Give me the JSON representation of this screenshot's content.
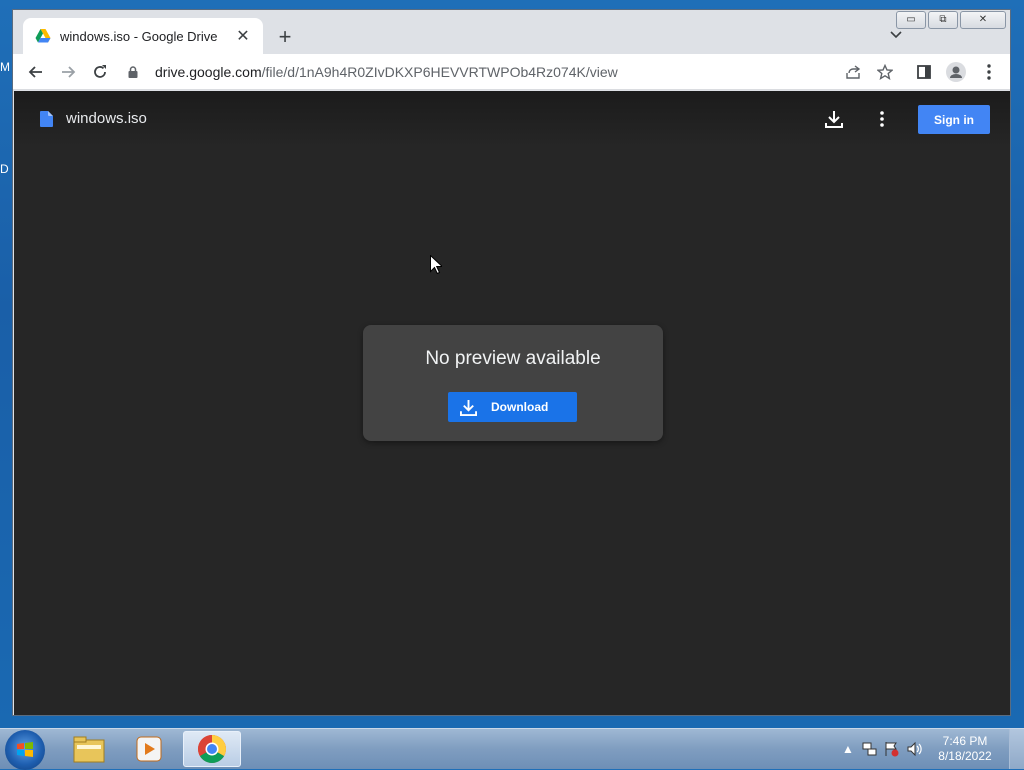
{
  "desktop": {
    "peek1": "M",
    "peek2": "D"
  },
  "tab": {
    "title": "windows.iso - Google Drive",
    "close": "✕",
    "new_tab": "+"
  },
  "window_controls": {
    "minimize": "▭",
    "maximize": "⧉",
    "close": "✕"
  },
  "address_bar": {
    "domain": "drive.google.com",
    "path": "/file/d/1nA9h4R0ZIvDKXP6HEVVRTWPOb4Rz074K/view"
  },
  "viewer": {
    "file_name": "windows.iso",
    "sign_in_label": "Sign in",
    "preview_message": "No preview available",
    "download_label": "Download"
  },
  "taskbar": {
    "time": "7:46 PM",
    "date": "8/18/2022",
    "tray_up_arrow": "▲"
  },
  "colors": {
    "accent": "#1a73e8",
    "sign_in": "#4285f4",
    "viewer_bg": "#262626"
  },
  "icons": [
    "drive-favicon",
    "back-icon",
    "forward-icon",
    "reload-icon",
    "lock-icon",
    "share-icon",
    "star-icon",
    "side-panel-icon",
    "profile-icon",
    "menu-icon",
    "file-icon",
    "download-icon",
    "more-icon",
    "cursor-icon",
    "start-orb",
    "explorer-icon",
    "media-player-icon",
    "chrome-icon"
  ]
}
